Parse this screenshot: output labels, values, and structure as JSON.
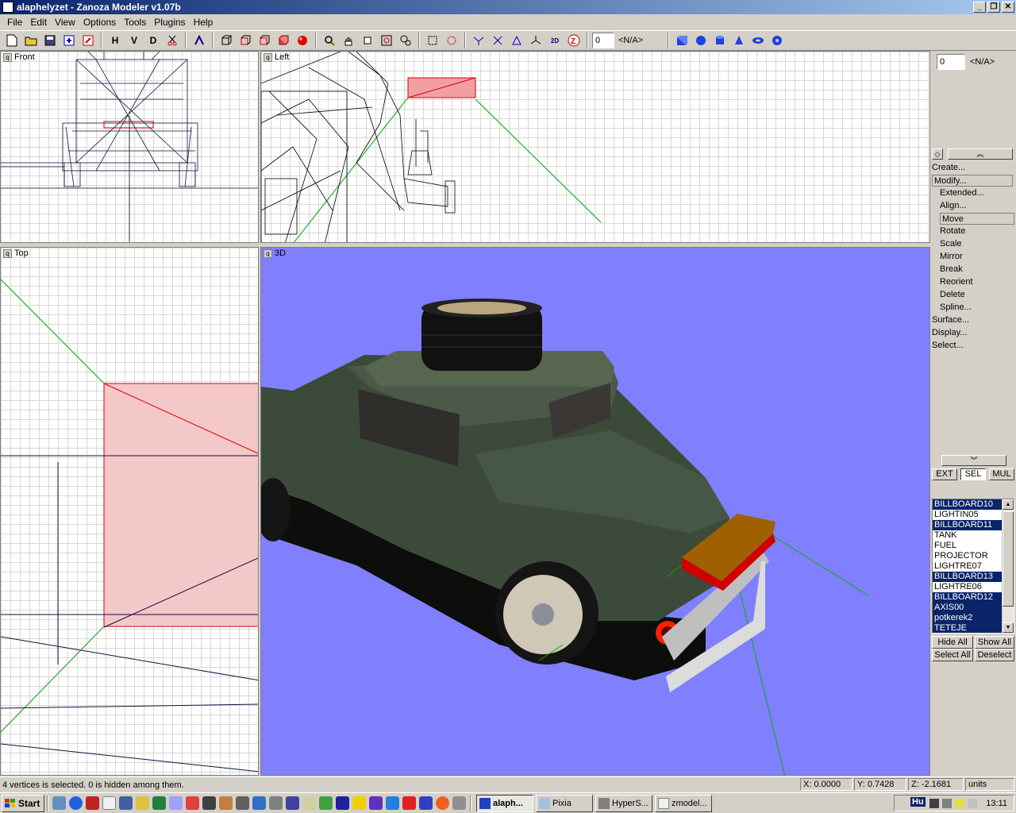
{
  "window": {
    "title": "alaphelyzet - Zanoza Modeler v1.07b",
    "min": "_",
    "restore": "❐",
    "close": "✕"
  },
  "menu": [
    "File",
    "Edit",
    "View",
    "Options",
    "Tools",
    "Plugins",
    "Help"
  ],
  "toolbar": {
    "h": "H",
    "v": "V",
    "d": "D",
    "spin_value": "0",
    "na": "<N/A>"
  },
  "viewports": {
    "front": "Front",
    "left": "Left",
    "top": "Top",
    "view3d": "3D"
  },
  "panel": {
    "spin_value": "0",
    "na": "<N/A>",
    "commands": [
      "Create...",
      "Modify...",
      "Extended...",
      "Align...",
      "Move",
      "Rotate",
      "Scale",
      "Mirror",
      "Break",
      "Reorient",
      "Delete",
      "Spline...",
      "Surface...",
      "Display...",
      "Select..."
    ],
    "tabs": [
      "EXT",
      "SEL",
      "MUL"
    ],
    "objects": [
      {
        "name": "BILLBOARD10",
        "selected": true
      },
      {
        "name": "LIGHTIN05",
        "selected": false
      },
      {
        "name": "BILLBOARD11",
        "selected": true
      },
      {
        "name": "TANK",
        "selected": false
      },
      {
        "name": "FUEL",
        "selected": false
      },
      {
        "name": "PROJECTOR",
        "selected": false
      },
      {
        "name": "LIGHTRE07",
        "selected": false
      },
      {
        "name": "BILLBOARD13",
        "selected": true
      },
      {
        "name": "LIGHTRE06",
        "selected": false
      },
      {
        "name": "BILLBOARD12",
        "selected": true
      },
      {
        "name": "AXIS00",
        "selected": true
      },
      {
        "name": "potkerek2",
        "selected": true
      },
      {
        "name": "TETEJE",
        "selected": true
      }
    ],
    "buttons": {
      "hide_all": "Hide All",
      "show_all": "Show All",
      "select_all": "Select All",
      "deselect": "Deselect"
    }
  },
  "status": {
    "message": "4 vertices is selected. 0 is hidden among them.",
    "x": "X: 0.0000",
    "y": "Y: 0.7428",
    "z": "Z: -2.1681",
    "units": "units"
  },
  "taskbar": {
    "start": "Start",
    "tasks": [
      "alaph...",
      "Pixia",
      "HyperS...",
      "zmodel..."
    ],
    "lang": "Hu",
    "clock": "13:11"
  }
}
